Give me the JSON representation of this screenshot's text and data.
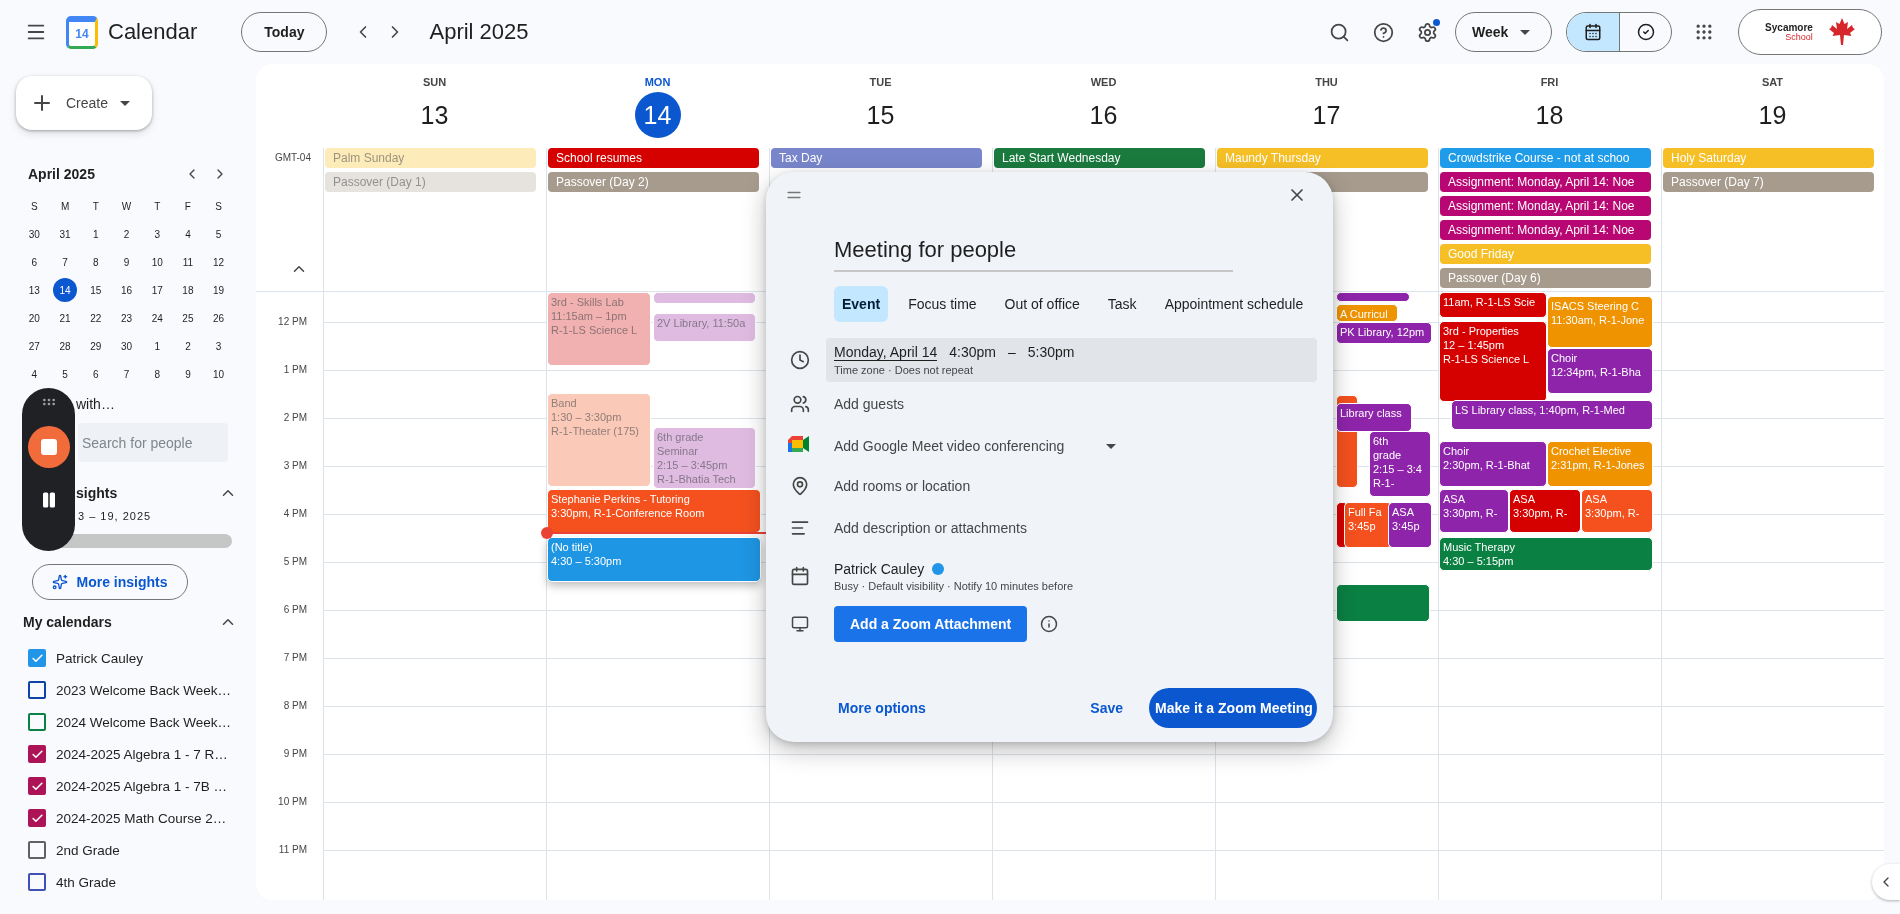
{
  "header": {
    "app_name": "Calendar",
    "logo_day": "14",
    "today_button": "Today",
    "period": "April 2025",
    "view": "Week",
    "settings_badge": true,
    "view_toggle": [
      {
        "kind": "calendar",
        "selected": true
      },
      {
        "kind": "tasks",
        "selected": false
      }
    ],
    "account": {
      "brand": "Sycamore",
      "sub": "School"
    }
  },
  "sidebar": {
    "create": "Create",
    "mini_calendar": {
      "title": "April 2025",
      "weekdays": [
        "S",
        "M",
        "T",
        "W",
        "T",
        "F",
        "S"
      ],
      "weeks": [
        [
          {
            "day": "30",
            "selected": false
          },
          {
            "day": "31",
            "selected": false
          },
          {
            "day": "1",
            "selected": false
          },
          {
            "day": "2",
            "selected": false
          },
          {
            "day": "3",
            "selected": false
          },
          {
            "day": "4",
            "selected": false
          },
          {
            "day": "5",
            "selected": false
          }
        ],
        [
          {
            "day": "6",
            "selected": false
          },
          {
            "day": "7",
            "selected": false
          },
          {
            "day": "8",
            "selected": false
          },
          {
            "day": "9",
            "selected": false
          },
          {
            "day": "10",
            "selected": false
          },
          {
            "day": "11",
            "selected": false
          },
          {
            "day": "12",
            "selected": false
          }
        ],
        [
          {
            "day": "13",
            "selected": false
          },
          {
            "day": "14",
            "selected": true
          },
          {
            "day": "15",
            "selected": false
          },
          {
            "day": "16",
            "selected": false
          },
          {
            "day": "17",
            "selected": false
          },
          {
            "day": "18",
            "selected": false
          },
          {
            "day": "19",
            "selected": false
          }
        ],
        [
          {
            "day": "20",
            "selected": false
          },
          {
            "day": "21",
            "selected": false
          },
          {
            "day": "22",
            "selected": false
          },
          {
            "day": "23",
            "selected": false
          },
          {
            "day": "24",
            "selected": false
          },
          {
            "day": "25",
            "selected": false
          },
          {
            "day": "26",
            "selected": false
          }
        ],
        [
          {
            "day": "27",
            "selected": false
          },
          {
            "day": "28",
            "selected": false
          },
          {
            "day": "29",
            "selected": false
          },
          {
            "day": "30",
            "selected": false
          },
          {
            "day": "1",
            "selected": false
          },
          {
            "day": "2",
            "selected": false
          },
          {
            "day": "3",
            "selected": false
          }
        ],
        [
          {
            "day": "4",
            "selected": false
          },
          {
            "day": "5",
            "selected": false
          },
          {
            "day": "6",
            "selected": false
          },
          {
            "day": "7",
            "selected": false
          },
          {
            "day": "8",
            "selected": false
          },
          {
            "day": "9",
            "selected": false
          },
          {
            "day": "10",
            "selected": false
          }
        ]
      ]
    },
    "meet": {
      "label": "with…",
      "placeholder": "Search for people"
    },
    "recorder": {
      "recording": true
    },
    "insights": {
      "title": "sights",
      "range": "3 – 19, 2025",
      "level": 0.03,
      "button": "More insights",
      "expanded": true
    },
    "my_calendars": {
      "title": "My calendars",
      "expanded": true,
      "items": [
        {
          "name": "Patrick Cauley",
          "color": "#2196e8",
          "checked": true
        },
        {
          "name": "2023 Welcome Back Week…",
          "color": "#0b43a8",
          "checked": false
        },
        {
          "name": "2024 Welcome Back Week…",
          "color": "#0b8043",
          "checked": false
        },
        {
          "name": "2024-2025 Algebra 1 - 7 R…",
          "color": "#ad1457",
          "checked": true
        },
        {
          "name": "2024-2025 Algebra 1 - 7B …",
          "color": "#ad1457",
          "checked": true
        },
        {
          "name": "2024-2025 Math Course 2…",
          "color": "#ad1457",
          "checked": true
        },
        {
          "name": "2nd Grade",
          "color": "#616161",
          "checked": false
        },
        {
          "name": "4th Grade",
          "color": "#3f51b5",
          "checked": false
        }
      ]
    }
  },
  "calendar": {
    "timezone": "GMT-04",
    "hours": [
      "12 PM",
      "1 PM",
      "2 PM",
      "3 PM",
      "4 PM",
      "5 PM",
      "6 PM",
      "7 PM",
      "8 PM",
      "9 PM",
      "10 PM",
      "11 PM"
    ],
    "days": [
      {
        "name": "SUN",
        "date": "13",
        "today": false,
        "all_day": [
          {
            "title": "Palm Sunday",
            "color": "#fdebb9",
            "past": true
          },
          {
            "title": "Passover (Day 1)",
            "color": "#e6e3df",
            "past": true
          }
        ]
      },
      {
        "name": "MON",
        "date": "14",
        "today": true,
        "all_day": [
          {
            "title": "School resumes",
            "color": "#d50000",
            "past": false
          },
          {
            "title": "Passover (Day 2)",
            "color": "#a79b8e",
            "past": false
          }
        ],
        "events": [
          {
            "color": "#dfbbe2"
          },
          {
            "lines": [
              "3rd - Skills Lab",
              "11:15am – 1pm",
              "R-1-LS Science L"
            ],
            "color": "#f0b1b0",
            "past": true
          },
          {
            "lines": [
              "2V Library, 11:50a"
            ],
            "color": "#dfbbe2",
            "past": true
          },
          {
            "lines": [
              "Band",
              "1:30 – 3:30pm",
              "R-1-Theater (175)"
            ],
            "color": "#fac9b8",
            "past": true
          },
          {
            "lines": [
              "6th grade",
              "Seminar",
              "2:15 – 3:45pm",
              "R-1-Bhatia Tech"
            ],
            "color": "#dfbbe2",
            "past": true
          },
          {
            "lines": [
              "Stephanie Perkins - Tutoring",
              "3:30pm, R-1-Conference Room"
            ],
            "color": "#f4511e",
            "past": false
          },
          {
            "lines": [
              "(No title)",
              "4:30 – 5:30pm"
            ],
            "color": "#1e96e3",
            "past": false
          }
        ]
      },
      {
        "name": "TUE",
        "date": "15",
        "today": false,
        "all_day": [
          {
            "title": "Tax Day",
            "color": "#7986cb",
            "past": false
          }
        ]
      },
      {
        "name": "WED",
        "date": "16",
        "today": false,
        "all_day": [
          {
            "title": "Late Start Wednesday",
            "color": "#1b7a3e",
            "past": false
          }
        ]
      },
      {
        "name": "THU",
        "date": "17",
        "today": false,
        "all_day": [
          {
            "title": "Maundy Thursday",
            "color": "#f6bf26",
            "past": false
          },
          {
            "color": "#a79b8e"
          }
        ],
        "events": [
          {
            "color": "#8e24aa"
          },
          {
            "lines": [
              "A Curricul"
            ],
            "color": "#f09300",
            "past": false
          },
          {
            "lines": [
              "PK Library, 12pm"
            ],
            "color": "#8e24aa",
            "past": false
          },
          {
            "color": "#f4511e"
          },
          {
            "lines": [
              "Library class"
            ],
            "color": "#8e24aa",
            "past": false
          },
          {
            "lines": [
              "6th",
              "grade",
              "2:15 – 3:4",
              "R-1-"
            ],
            "color": "#8e24aa",
            "past": false
          },
          {
            "color": "#d50000"
          },
          {
            "lines": [
              "Full Fa",
              "3:45p"
            ],
            "color": "#f4511e",
            "past": false
          },
          {
            "lines": [
              "ASA",
              "3:45p"
            ],
            "color": "#8e24aa",
            "past": false
          },
          {
            "color": "#0b8043"
          }
        ]
      },
      {
        "name": "FRI",
        "date": "18",
        "today": false,
        "all_day": [
          {
            "title": "Crowdstrike Course - not at schoo",
            "color": "#1e9be9",
            "past": false
          },
          {
            "title": "Assignment: Monday, April 14: Noe",
            "color": "#b80672",
            "past": false
          },
          {
            "title": "Assignment: Monday, April 14: Noe",
            "color": "#b80672",
            "past": false
          },
          {
            "title": "Assignment: Monday, April 14: Noe",
            "color": "#b80672",
            "past": false
          },
          {
            "title": "Good Friday",
            "color": "#f6bf26",
            "past": false
          },
          {
            "title": "Passover (Day 6)",
            "color": "#a79b8e",
            "past": false
          }
        ],
        "events": [
          {
            "lines": [
              "11am, R-1-LS Scie"
            ],
            "color": "#d50000",
            "past": false
          },
          {
            "lines": [
              "ISACS Steering C",
              "11:30am, R-1-Jone"
            ],
            "color": "#f09300",
            "past": false
          },
          {
            "lines": [
              "3rd - Properties",
              "12 – 1:45pm",
              "R-1-LS Science L"
            ],
            "color": "#d50000",
            "past": false
          },
          {
            "lines": [
              "Choir",
              "12:34pm, R-1-Bha"
            ],
            "color": "#8e24aa",
            "past": false
          },
          {
            "lines": [
              "LS Library class, 1:40pm, R-1-Med"
            ],
            "color": "#8e24aa",
            "past": false
          },
          {
            "lines": [
              "Choir",
              "2:30pm, R-1-Bhat"
            ],
            "color": "#8e24aa",
            "past": false
          },
          {
            "lines": [
              "Crochet Elective",
              "2:31pm, R-1-Jones"
            ],
            "color": "#f09300",
            "past": false
          },
          {
            "lines": [
              "ASA",
              "3:30pm, R-"
            ],
            "color": "#8e24aa",
            "past": false
          },
          {
            "lines": [
              "ASA",
              "3:30pm, R-"
            ],
            "color": "#d50000",
            "past": false
          },
          {
            "lines": [
              "ASA",
              "3:30pm, R-"
            ],
            "color": "#f4511e",
            "past": false
          },
          {
            "lines": [
              "Music Therapy",
              "4:30 – 5:15pm"
            ],
            "color": "#0b8043",
            "past": false
          }
        ]
      },
      {
        "name": "SAT",
        "date": "19",
        "today": false,
        "all_day": [
          {
            "title": "Holy Saturday",
            "color": "#f6bf26",
            "past": false
          },
          {
            "title": "Passover (Day 7)",
            "color": "#a79b8e",
            "past": false
          }
        ]
      }
    ]
  },
  "dialog": {
    "title": "Meeting for people",
    "tabs": [
      {
        "label": "Event",
        "selected": true
      },
      {
        "label": "Focus time",
        "selected": false
      },
      {
        "label": "Out of office",
        "selected": false
      },
      {
        "label": "Task",
        "selected": false
      },
      {
        "label": "Appointment schedule",
        "selected": false
      }
    ],
    "date": "Monday, April 14",
    "start": "4:30pm",
    "dash": "–",
    "end": "5:30pm",
    "date_note": "Time zone · Does not repeat",
    "guests": "Add guests",
    "meet": "Add Google Meet video conferencing",
    "location": "Add rooms or location",
    "description": "Add description or attachments",
    "owner": {
      "name": "Patrick Cauley",
      "color": "#2196e8",
      "note": "Busy · Default visibility · Notify 10 minutes before"
    },
    "zoom_button": "Add a Zoom Attachment",
    "more_options": "More options",
    "save": "Save",
    "primary": "Make it a Zoom Meeting"
  }
}
